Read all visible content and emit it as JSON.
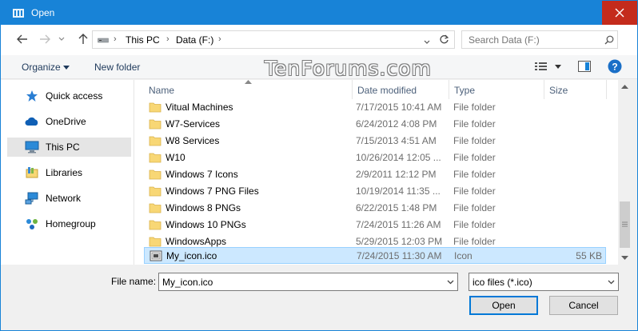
{
  "window": {
    "title": "Open"
  },
  "address": {
    "crumbs": [
      "This PC",
      "Data (F:)"
    ]
  },
  "search": {
    "placeholder": "Search Data (F:)"
  },
  "toolbar": {
    "organize_label": "Organize",
    "new_folder_label": "New folder",
    "watermark": "TenForums.com"
  },
  "sidebar": {
    "items": [
      {
        "label": "Quick access",
        "icon": "star-icon"
      },
      {
        "label": "OneDrive",
        "icon": "cloud-icon"
      },
      {
        "label": "This PC",
        "icon": "computer-icon"
      },
      {
        "label": "Libraries",
        "icon": "libraries-icon"
      },
      {
        "label": "Network",
        "icon": "network-icon"
      },
      {
        "label": "Homegroup",
        "icon": "homegroup-icon"
      }
    ],
    "selected": "This PC"
  },
  "columns": {
    "name": "Name",
    "date": "Date modified",
    "type": "Type",
    "size": "Size"
  },
  "files": [
    {
      "name": "Vitual Machines",
      "date": "7/17/2015 10:41 AM",
      "type": "File folder",
      "size": ""
    },
    {
      "name": "W7-Services",
      "date": "6/24/2012 4:08 PM",
      "type": "File folder",
      "size": ""
    },
    {
      "name": "W8 Services",
      "date": "7/15/2013 4:51 AM",
      "type": "File folder",
      "size": ""
    },
    {
      "name": "W10",
      "date": "10/26/2014 12:05 ...",
      "type": "File folder",
      "size": ""
    },
    {
      "name": "Windows 7 Icons",
      "date": "2/9/2011 12:12 PM",
      "type": "File folder",
      "size": ""
    },
    {
      "name": "Windows 7 PNG Files",
      "date": "10/19/2014 11:35 ...",
      "type": "File folder",
      "size": ""
    },
    {
      "name": "Windows 8 PNGs",
      "date": "6/22/2015 1:48 PM",
      "type": "File folder",
      "size": ""
    },
    {
      "name": "Windows 10 PNGs",
      "date": "7/24/2015 11:26 AM",
      "type": "File folder",
      "size": ""
    },
    {
      "name": "WindowsApps",
      "date": "5/29/2015 12:03 PM",
      "type": "File folder",
      "size": ""
    },
    {
      "name": "My_icon.ico",
      "date": "7/24/2015 11:30 AM",
      "type": "Icon",
      "size": "55 KB"
    }
  ],
  "selected_file": "My_icon.ico",
  "footer": {
    "filename_label": "File name:",
    "filename_value": "My_icon.ico",
    "filetype_value": "ico files (*.ico)",
    "open_label": "Open",
    "cancel_label": "Cancel"
  },
  "colors": {
    "titlebar": "#1883d7",
    "close": "#c42b1c",
    "selection": "#cce8ff",
    "folder": "#f8d775"
  }
}
